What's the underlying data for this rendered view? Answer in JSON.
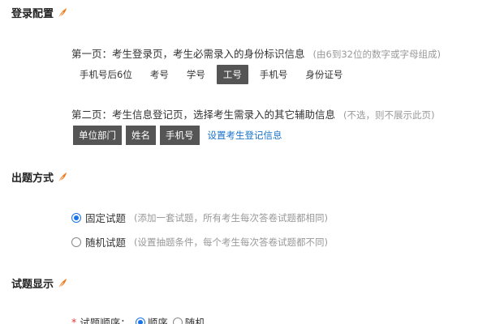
{
  "login_config": {
    "title": "登录配置",
    "page1_text": "第一页：考生登录页，考生必需录入的身份标识信息",
    "page1_hint": "(由6到32位的数字或字母组成)",
    "id_options": [
      {
        "label": "手机号后6位",
        "active": false
      },
      {
        "label": "考号",
        "active": false
      },
      {
        "label": "学号",
        "active": false
      },
      {
        "label": "工号",
        "active": true
      },
      {
        "label": "手机号",
        "active": false
      },
      {
        "label": "身份证号",
        "active": false
      }
    ],
    "page2_text": "第二页：考生信息登记页，选择考生需录入的其它辅助信息",
    "page2_hint": "(不选，则不展示此页)",
    "extra_fields": [
      "单位部门",
      "姓名",
      "手机号"
    ],
    "setup_link": "设置考生登记信息"
  },
  "question_mode": {
    "title": "出题方式",
    "options": [
      {
        "label": "固定试题",
        "hint": "(添加一套试题，所有考生每次答卷试题都相同)",
        "checked": true
      },
      {
        "label": "随机试题",
        "hint": "(设置抽题条件，每个考生每次答卷试题都不同)",
        "checked": false
      }
    ]
  },
  "display": {
    "title": "试题显示",
    "order_label": "试题顺序：",
    "order_options": [
      {
        "label": "顺序",
        "checked": true
      },
      {
        "label": "随机",
        "checked": false
      }
    ]
  },
  "colors": {
    "accent": "#1a73e8",
    "feather": "#f07c1e",
    "tag_bg": "#555555"
  }
}
